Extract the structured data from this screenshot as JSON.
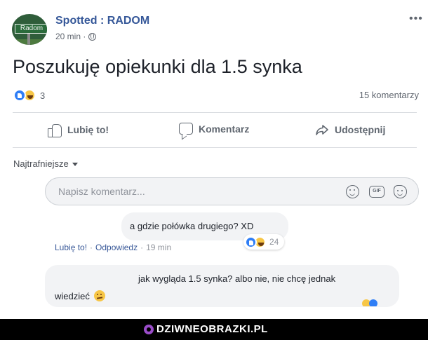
{
  "post": {
    "page_name": "Spotted : RADOM",
    "avatar_text": "Radom",
    "time": "20 min ·",
    "text": "Poszukuję opiekunki dla 1.5 synka",
    "reaction_count": "3",
    "comment_count": "15 komentarzy"
  },
  "actions": {
    "like": "Lubię to!",
    "comment": "Komentarz",
    "share": "Udostępnij"
  },
  "sort_label": "Najtrafniejsze",
  "comment_input": {
    "placeholder": "Napisz komentarz..."
  },
  "comments": [
    {
      "text": "a gdzie połówka drugiego? XD",
      "like_label": "Lubię to!",
      "reply_label": "Odpowiedz",
      "time": "19 min",
      "reaction_count": "24"
    },
    {
      "text_line1": "jak wygląda 1.5 synka? albo nie, nie chcę jednak",
      "text_line2": "wiedzieć"
    }
  ],
  "watermark": "DZIWNEOBRAZKI.PL",
  "colors": {
    "link_blue": "#365899",
    "like_blue": "#2f7ef6",
    "haha_yellow": "#f7c646",
    "bubble_gray": "#f2f3f5",
    "watermark_purple": "#9b4dca"
  },
  "icons": [
    "globe-icon",
    "more-icon",
    "like-icon",
    "haha-icon",
    "thumb-icon",
    "comment-icon",
    "share-icon",
    "smile-icon",
    "gif-icon",
    "sticker-icon",
    "caret-down-icon"
  ]
}
